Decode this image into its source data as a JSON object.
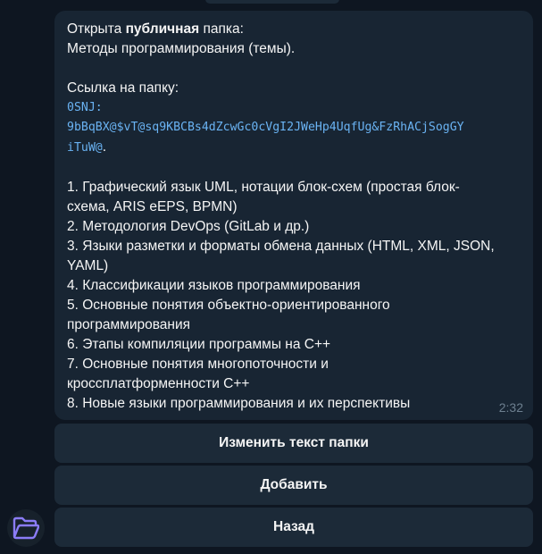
{
  "message": {
    "line1_prefix": "Открыта ",
    "line1_bold": "публичная",
    "line1_suffix": " папка:",
    "line2": "Методы программирования (темы).",
    "link_label": "Ссылка на папку:",
    "code_line1": "0SNJ:",
    "code_line2": "9bBqBX@$vT@sq9KBCBs4dZcwGc0cVgI2JWeHp4UqfUg&FzRhACjSogGY",
    "code_line3": "iTuW@",
    "code_end": ".",
    "topic_lines": [
      "1.  Графический язык UML, нотации блок-схем (простая блок-",
      "схема, ARIS eEPS, BPMN)",
      "2.  Методология DevOps (GitLab и др.)",
      "3.  Языки разметки и форматы обмена данных (HTML, XML, JSON,",
      "YAML)",
      "4.  Классификации языков программирования",
      "5.  Основные понятия объектно-ориентированного",
      "программирования",
      "6.  Этапы компиляции программы на С++",
      "7.  Основные понятия многопоточности и",
      "кроссплатформенности С++",
      "8.  Новые языки программирования и их перспективы"
    ],
    "time": "2:32"
  },
  "buttons": {
    "edit_label": "Изменить текст папки",
    "add_label": "Добавить",
    "back_label": "Назад"
  },
  "colors": {
    "background": "#0e1621",
    "bubble": "#182533",
    "button": "#1c2a38",
    "link": "#6ab3f3",
    "time": "#6d7f8f",
    "avatar_icon": "#8b7cf6"
  },
  "icons": {
    "avatar": "folder-open-icon"
  }
}
